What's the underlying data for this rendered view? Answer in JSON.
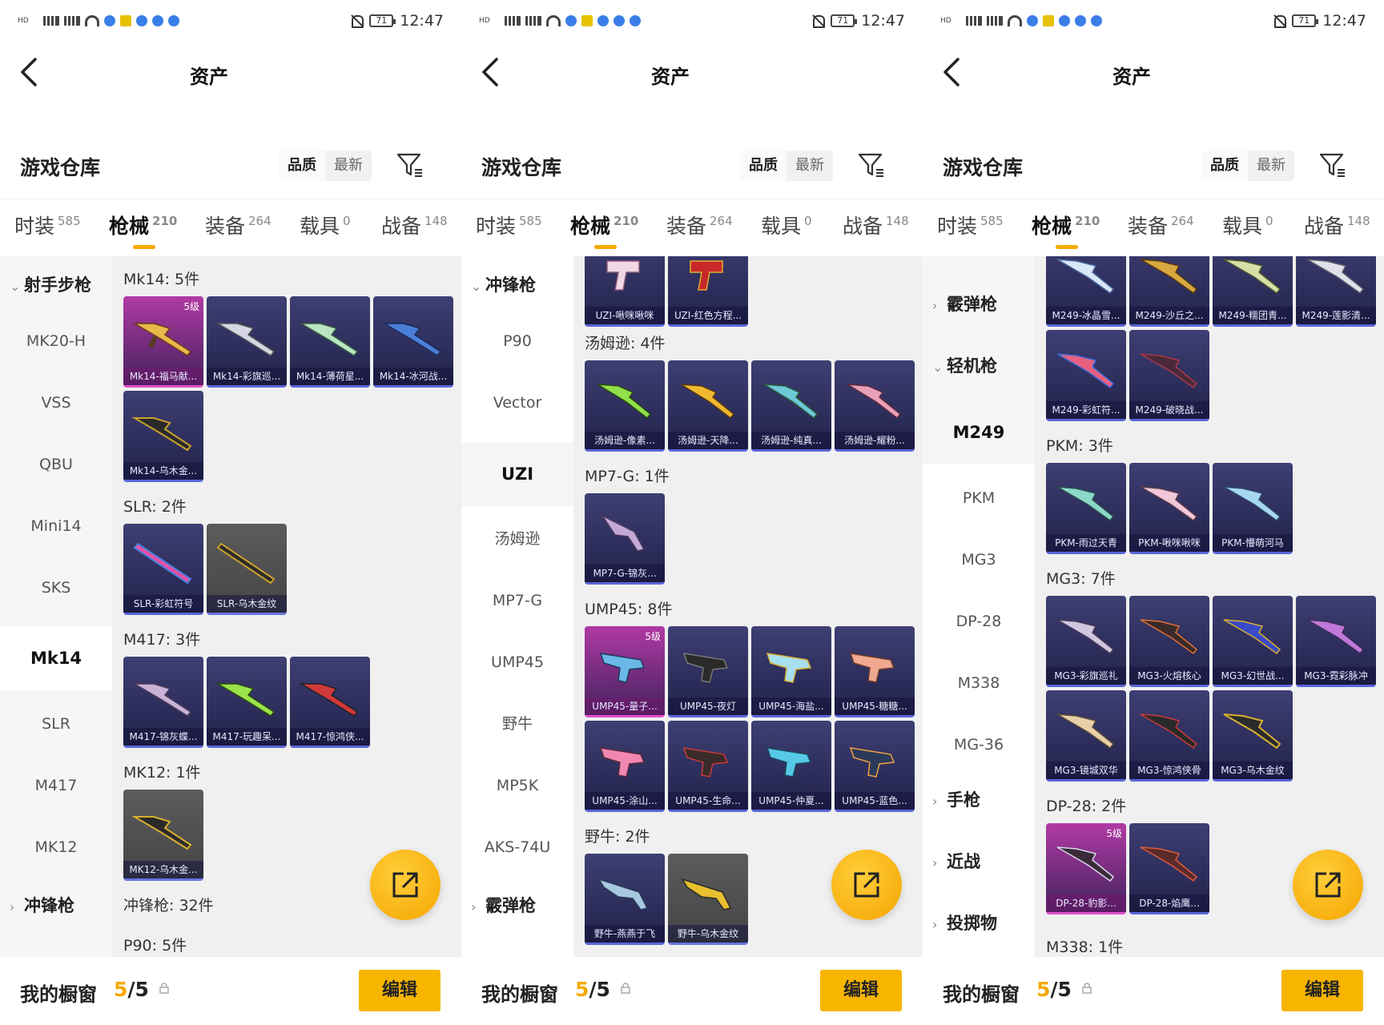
{
  "status": {
    "network_a": "5G",
    "network_b": "4G",
    "battery": "71",
    "time": "12:47"
  },
  "header": {
    "title": "资产"
  },
  "warehouse": {
    "title": "游戏仓库",
    "sort": [
      "品质",
      "最新"
    ]
  },
  "tabs": [
    {
      "label": "时装",
      "count": "585"
    },
    {
      "label": "枪械",
      "count": "210"
    },
    {
      "label": "装备",
      "count": "264"
    },
    {
      "label": "载具",
      "count": "0"
    },
    {
      "label": "战备",
      "count": "148"
    }
  ],
  "bottom": {
    "label": "我的橱窗",
    "count_current": "5",
    "count_total": "/5",
    "edit": "编辑"
  },
  "screen1": {
    "sidebar": {
      "cat_top": "射手步枪",
      "items": [
        "MK20-H",
        "VSS",
        "QBU",
        "Mini14",
        "SKS",
        "Mk14",
        "SLR",
        "M417",
        "MK12"
      ],
      "cat_bottom": "冲锋枪"
    },
    "sections": [
      {
        "title": "Mk14: 5件",
        "items": [
          {
            "name": "Mk14-福马献...",
            "level": "5级"
          },
          {
            "name": "Mk14-彩旗巡..."
          },
          {
            "name": "Mk14-薄荷星..."
          },
          {
            "name": "Mk14-冰河战..."
          },
          {
            "name": "Mk14-乌木金..."
          }
        ]
      },
      {
        "title": "SLR: 2件",
        "items": [
          {
            "name": "SLR-彩虹符号"
          },
          {
            "name": "SLR-乌木金纹"
          }
        ]
      },
      {
        "title": "M417: 3件",
        "items": [
          {
            "name": "M417-锦灰蝶..."
          },
          {
            "name": "M417-玩趣呆..."
          },
          {
            "name": "M417-惊鸿侠..."
          }
        ]
      },
      {
        "title": "MK12: 1件",
        "items": [
          {
            "name": "MK12-乌木金..."
          }
        ]
      },
      {
        "title": "冲锋枪: 32件",
        "items": []
      },
      {
        "title": "P90: 5件",
        "items": []
      }
    ]
  },
  "screen2": {
    "sidebar": {
      "cat_top": "冲锋枪",
      "items": [
        "P90",
        "Vector",
        "UZI",
        "汤姆逊",
        "MP7-G",
        "UMP45",
        "野牛",
        "MP5K",
        "AKS-74U"
      ],
      "cat_bottom": "霰弹枪"
    },
    "sections": [
      {
        "title": "",
        "items": [
          {
            "name": "UZI-啾咪啾咪"
          },
          {
            "name": "UZI-红色方程..."
          }
        ]
      },
      {
        "title": "汤姆逊: 4件",
        "items": [
          {
            "name": "汤姆逊-像素..."
          },
          {
            "name": "汤姆逊-天降..."
          },
          {
            "name": "汤姆逊-纯真..."
          },
          {
            "name": "汤姆逊-耀粉..."
          }
        ]
      },
      {
        "title": "MP7-G: 1件",
        "items": [
          {
            "name": "MP7-G-锦灰..."
          }
        ]
      },
      {
        "title": "UMP45: 8件",
        "items": [
          {
            "name": "UMP45-量子...",
            "level": "5级"
          },
          {
            "name": "UMP45-夜灯"
          },
          {
            "name": "UMP45-海盐..."
          },
          {
            "name": "UMP45-糖糖..."
          },
          {
            "name": "UMP45-涂山..."
          },
          {
            "name": "UMP45-生命..."
          },
          {
            "name": "UMP45-仲夏..."
          },
          {
            "name": "UMP45-蓝色..."
          }
        ]
      },
      {
        "title": "野牛: 2件",
        "items": [
          {
            "name": "野牛-燕燕于飞"
          },
          {
            "name": "野牛-乌木金纹"
          }
        ]
      }
    ]
  },
  "screen3": {
    "sidebar": {
      "cats_top": [
        "霰弹枪",
        "轻机枪"
      ],
      "items": [
        "M249",
        "PKM",
        "MG3",
        "DP-28",
        "M338",
        "MG-36"
      ],
      "cats_bottom": [
        "手枪",
        "近战",
        "投掷物"
      ]
    },
    "sections": [
      {
        "title": "",
        "items": [
          {
            "name": "M249-冰晶雪..."
          },
          {
            "name": "M249-沙丘之..."
          },
          {
            "name": "M249-糯团青..."
          },
          {
            "name": "M249-莲影清..."
          },
          {
            "name": "M249-彩虹符..."
          },
          {
            "name": "M249-破晓战..."
          }
        ]
      },
      {
        "title": "PKM: 3件",
        "items": [
          {
            "name": "PKM-雨过天青"
          },
          {
            "name": "PKM-啾咪啾咪"
          },
          {
            "name": "PKM-懵萌河马"
          }
        ]
      },
      {
        "title": "MG3: 7件",
        "items": [
          {
            "name": "MG3-彩旗巡礼"
          },
          {
            "name": "MG3-火熔核心"
          },
          {
            "name": "MG3-幻世战..."
          },
          {
            "name": "MG3-霓彩脉冲"
          },
          {
            "name": "MG3-镜城双华"
          },
          {
            "name": "MG3-惊鸿侠骨"
          },
          {
            "name": "MG3-乌木金纹"
          }
        ]
      },
      {
        "title": "DP-28: 2件",
        "items": [
          {
            "name": "DP-28-豹影...",
            "level": "5级"
          },
          {
            "name": "DP-28-焰鹰..."
          }
        ]
      },
      {
        "title": "M338: 1件",
        "items": []
      }
    ]
  },
  "colors": {
    "accent": "#f5a800",
    "card_blue": "#2a2b57",
    "card_gold": "#b13aa4",
    "card_grey": "#555555"
  }
}
